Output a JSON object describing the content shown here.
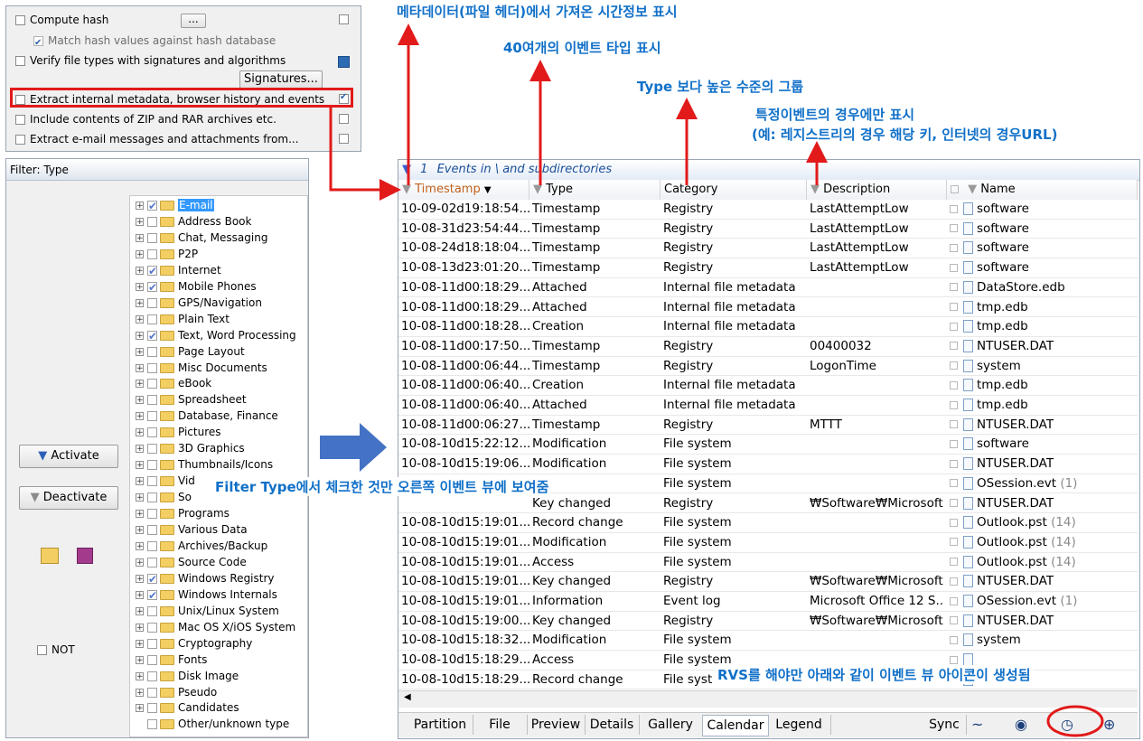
{
  "options": {
    "compute_hash": {
      "label": "Compute hash",
      "button": "..."
    },
    "match_hash": {
      "label": "Match hash values against hash database"
    },
    "verify_types": {
      "label": "Verify file types with signatures and algorithms"
    },
    "signatures_button": "Signatures...",
    "extract_metadata": {
      "label": "Extract internal metadata, browser history and events"
    },
    "include_zip": {
      "label": "Include contents of ZIP and RAR archives etc."
    },
    "extract_email": {
      "label": "Extract e-mail messages and attachments from..."
    }
  },
  "filter": {
    "title": "Filter: Type",
    "activate": "Activate",
    "deactivate": "Deactivate",
    "not_label": "NOT",
    "types": [
      {
        "label": "E-mail",
        "checked": true,
        "selected": true
      },
      {
        "label": "Address Book",
        "checked": false
      },
      {
        "label": "Chat, Messaging",
        "checked": false
      },
      {
        "label": "P2P",
        "checked": false
      },
      {
        "label": "Internet",
        "checked": true
      },
      {
        "label": "Mobile Phones",
        "checked": true
      },
      {
        "label": "GPS/Navigation",
        "checked": false
      },
      {
        "label": "Plain Text",
        "checked": false
      },
      {
        "label": "Text, Word Processing",
        "checked": true
      },
      {
        "label": "Page Layout",
        "checked": false
      },
      {
        "label": "Misc Documents",
        "checked": false
      },
      {
        "label": "eBook",
        "checked": false
      },
      {
        "label": "Spreadsheet",
        "checked": false
      },
      {
        "label": "Database, Finance",
        "checked": false
      },
      {
        "label": "Pictures",
        "checked": false
      },
      {
        "label": "3D Graphics",
        "checked": false
      },
      {
        "label": "Thumbnails/Icons",
        "checked": false
      },
      {
        "label": "Vid",
        "checked": false
      },
      {
        "label": "So",
        "checked": false
      },
      {
        "label": "Programs",
        "checked": false
      },
      {
        "label": "Various Data",
        "checked": false
      },
      {
        "label": "Archives/Backup",
        "checked": false
      },
      {
        "label": "Source Code",
        "checked": false
      },
      {
        "label": "Windows Registry",
        "checked": true
      },
      {
        "label": "Windows Internals",
        "checked": true
      },
      {
        "label": "Unix/Linux System",
        "checked": false
      },
      {
        "label": "Mac OS X/iOS System",
        "checked": false
      },
      {
        "label": "Cryptography",
        "checked": false
      },
      {
        "label": "Fonts",
        "checked": false
      },
      {
        "label": "Disk Image",
        "checked": false
      },
      {
        "label": "Pseudo",
        "checked": false
      },
      {
        "label": "Candidates",
        "checked": false
      },
      {
        "label": "Other/unknown type",
        "checked": false
      }
    ]
  },
  "events": {
    "title_count": "1",
    "title_path": "Events in \\ and subdirectories",
    "columns": [
      "Timestamp",
      "Type",
      "Category",
      "Description",
      "Name"
    ],
    "rows": [
      [
        "10-09-02d19:18:54...",
        "Timestamp",
        "Registry",
        "LastAttemptLow",
        "software",
        ""
      ],
      [
        "10-08-31d23:54:44...",
        "Timestamp",
        "Registry",
        "LastAttemptLow",
        "software",
        ""
      ],
      [
        "10-08-24d18:18:04...",
        "Timestamp",
        "Registry",
        "LastAttemptLow",
        "software",
        ""
      ],
      [
        "10-08-13d23:01:20...",
        "Timestamp",
        "Registry",
        "LastAttemptLow",
        "software",
        ""
      ],
      [
        "10-08-11d00:18:29...",
        "Attached",
        "Internal file metadata",
        "",
        "DataStore.edb",
        ""
      ],
      [
        "10-08-11d00:18:29...",
        "Attached",
        "Internal file metadata",
        "",
        "tmp.edb",
        ""
      ],
      [
        "10-08-11d00:18:28...",
        "Creation",
        "Internal file metadata",
        "",
        "tmp.edb",
        ""
      ],
      [
        "10-08-11d00:17:50...",
        "Timestamp",
        "Registry",
        "00400032",
        "NTUSER.DAT",
        ""
      ],
      [
        "10-08-11d00:06:44...",
        "Timestamp",
        "Registry",
        "LogonTime",
        "system",
        ""
      ],
      [
        "10-08-11d00:06:40...",
        "Creation",
        "Internal file metadata",
        "",
        "tmp.edb",
        ""
      ],
      [
        "10-08-11d00:06:40...",
        "Attached",
        "Internal file metadata",
        "",
        "tmp.edb",
        ""
      ],
      [
        "10-08-11d00:06:27...",
        "Timestamp",
        "Registry",
        "MTTT",
        "NTUSER.DAT",
        ""
      ],
      [
        "10-08-10d15:22:12...",
        "Modification",
        "File system",
        "",
        "software",
        ""
      ],
      [
        "10-08-10d15:19:06...",
        "Modification",
        "File system",
        "",
        "NTUSER.DAT",
        ""
      ],
      [
        "",
        "",
        "File system",
        "",
        "OSession.evt",
        "(1)"
      ],
      [
        "",
        "Key changed",
        "Registry",
        "₩Software₩Microsoft...",
        "NTUSER.DAT",
        ""
      ],
      [
        "10-08-10d15:19:01...",
        "Record change",
        "File system",
        "",
        "Outlook.pst",
        "(14)"
      ],
      [
        "10-08-10d15:19:01...",
        "Modification",
        "File system",
        "",
        "Outlook.pst",
        "(14)"
      ],
      [
        "10-08-10d15:19:01...",
        "Access",
        "File system",
        "",
        "Outlook.pst",
        "(14)"
      ],
      [
        "10-08-10d15:19:01...",
        "Key changed",
        "Registry",
        "₩Software₩Microsoft...",
        "NTUSER.DAT",
        ""
      ],
      [
        "10-08-10d15:19:01...",
        "Information",
        "Event log",
        "Microsoft Office 12 S...",
        "OSession.evt",
        "(1)"
      ],
      [
        "10-08-10d15:19:00...",
        "Key changed",
        "Registry",
        "₩Software₩Microsoft...",
        "NTUSER.DAT",
        ""
      ],
      [
        "10-08-10d15:18:32...",
        "Modification",
        "File system",
        "",
        "system",
        ""
      ],
      [
        "10-08-10d15:18:29...",
        "Access",
        "File system",
        "",
        "",
        ""
      ],
      [
        "10-08-10d15:18:29...",
        "Record change",
        "File syst",
        "",
        "",
        ""
      ]
    ],
    "tabs": [
      "Partition",
      "File",
      "Preview",
      "Details",
      "Gallery",
      "Calendar",
      "Legend",
      "Sync"
    ],
    "active_tab": "Calendar"
  },
  "annotations": {
    "timestamp_note": "메타데이터(파일 헤더)에서 가져온 시간정보 표시",
    "type_note": "40여개의 이벤트 타입 표시",
    "category_note": "Type 보다 높은 수준의 그룹",
    "desc_note_1": "특정이벤트의 경우에만 표시",
    "desc_note_2": "(예: 레지스트리의 경우 해당 키, 인터넷의 경우URL)",
    "filter_note": "Filter Type에서 체크한 것만 오른쪽 이벤트 뷰에 보여줌",
    "rvs_note": "RVS를 해야만 아래와 같이 이벤트 뷰 아이콘이 생성됨"
  },
  "colors": {
    "annotation": "#1070c8",
    "highlight": "#e21a1a",
    "arrow": "#4472c4"
  }
}
